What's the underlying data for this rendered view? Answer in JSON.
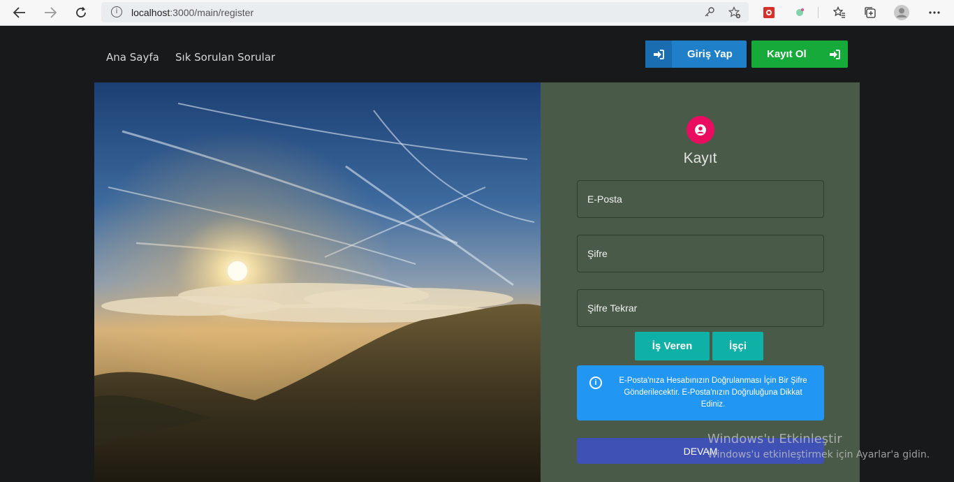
{
  "browser": {
    "url_host": "localhost",
    "url_rest": ":3000/main/register",
    "back_icon": "arrow-left-icon",
    "forward_icon": "arrow-right-icon",
    "refresh_icon": "refresh-icon"
  },
  "nav": {
    "links": [
      "Ana Sayfa",
      "Sık Sorulan Sorular"
    ],
    "login_label": "Giriş Yap",
    "register_label": "Kayıt Ol"
  },
  "form": {
    "title": "Kayıt",
    "email_placeholder": "E-Posta",
    "password_placeholder": "Şifre",
    "password_repeat_placeholder": "Şifre Tekrar",
    "role_employer": "İş Veren",
    "role_worker": "İşçi",
    "alert_text": "E-Posta'nıza Hesabınızın Doğrulanması İçin Bir Şifre Gönderilecektir. E-Posta'nızın Doğruluğuna Dikkat Ediniz.",
    "submit_label": "DEVAM"
  },
  "watermark": {
    "line1": "Windows'u Etkinleştir",
    "line2": "Windows'u etkinleştirmek için Ayarlar'a gidin."
  },
  "colors": {
    "page_bg": "#18191b",
    "panel_bg": "#495a48",
    "login_blue": "#1f7fc9",
    "register_green": "#16aa3a",
    "role_teal": "#0fb1a6",
    "alert_blue": "#2196f3",
    "submit_indigo": "#3f51b5",
    "avatar_pink": "#ea0d5f"
  }
}
